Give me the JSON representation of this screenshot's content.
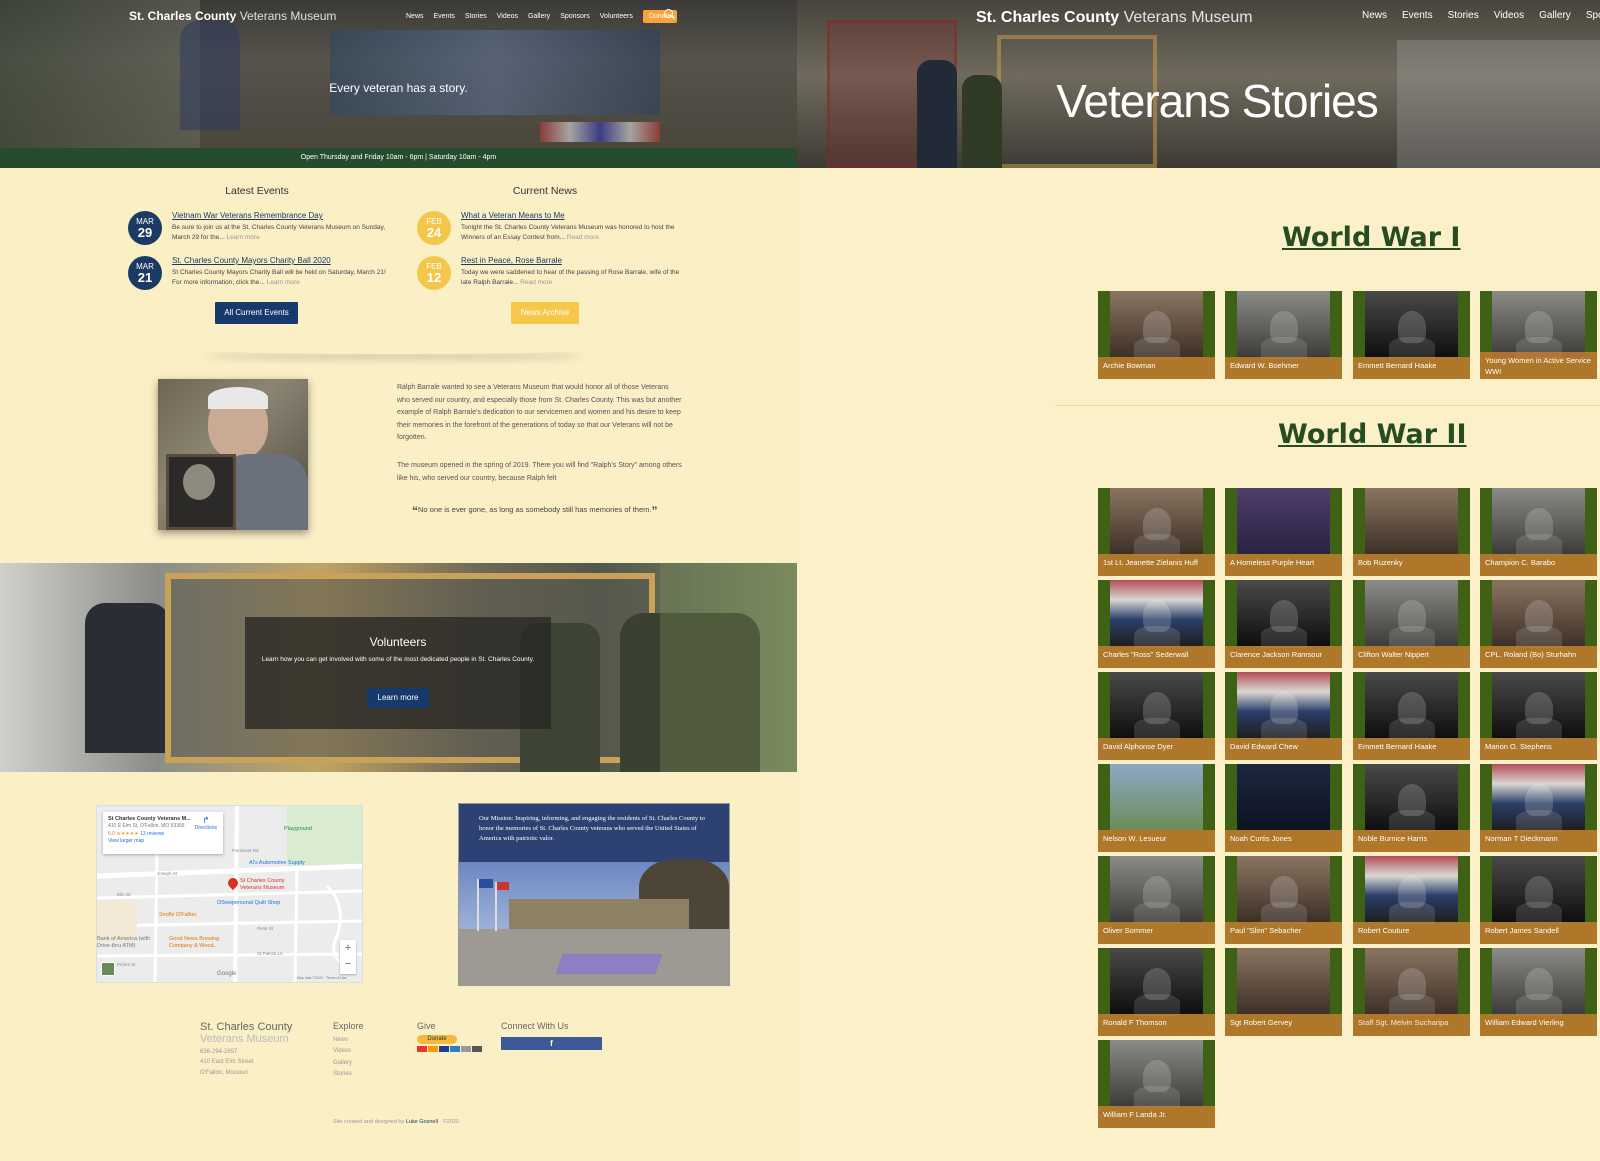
{
  "left_site": {
    "brand": {
      "main": "St. Charles County",
      "sub": "Veterans Museum"
    },
    "nav": [
      "News",
      "Events",
      "Stories",
      "Videos",
      "Gallery",
      "Sponsors",
      "Volunteers"
    ],
    "donate_label": "Donate",
    "tagline": "Every veteran has a story.",
    "hours": "Open Thursday and Friday 10am - 6pm | Saturday 10am - 4pm",
    "latest_events": {
      "heading": "Latest Events",
      "items": [
        {
          "month": "MAR",
          "day": "29",
          "title": "Vietnam War Veterans Remembrance Day",
          "body": "Be sure to join us at the St. Charles County Veterans Museum on Sunday, March 29 for the...",
          "more": "Learn more"
        },
        {
          "month": "MAR",
          "day": "21",
          "title": "St. Charles County Mayors Charity Ball 2020",
          "body": "St Charles County Mayors Charity Ball will be held on Saturday, March 21! For more information, click the...",
          "more": "Learn more"
        }
      ],
      "button": "All Current Events"
    },
    "current_news": {
      "heading": "Current News",
      "items": [
        {
          "month": "FEB",
          "day": "24",
          "title": "What a Veteran Means to Me",
          "body": "Tonight the St. Charles County Veterans Museum was honored to host the Winners of an Essay Contest from...",
          "more": "Read more"
        },
        {
          "month": "FEB",
          "day": "12",
          "title": "Rest in Peace, Rose Barrale",
          "body": "Today we were saddened to hear of the passing of Rose Barrale, wife of the late Ralph Barrale...",
          "more": "Read more"
        }
      ],
      "button": "News Archive"
    },
    "about": {
      "p1": "Ralph Barrale wanted to see a Veterans Museum that would honor all of those Veterans who served our country, and especially those from St. Charles County. This was but another example of Ralph Barrale's dedication to our servicemen and women and his desire to keep their memories in the forefront of the generations of today so that our Veterans will not be forgotten.",
      "p2": "The museum opened in the spring of 2019. There you will find \"Ralph's Story\" among others like his, who served our country, because Ralph felt",
      "quote": "No one is ever gone, as long as somebody still has memories of them."
    },
    "volunteers": {
      "heading": "Volunteers",
      "body": "Learn how you can get involved with some of the most dedicated people in St. Charles County.",
      "button": "Learn more"
    },
    "map": {
      "place": "St Charles County Veterans M...",
      "address": "410 E Elm St, O'Fallon, MO 63366",
      "rating": "5.0",
      "stars": "★★★★★",
      "reviews": "13 reviews",
      "larger": "View larger map",
      "directions": "Directions",
      "pin_label": "St Charles County Veterans Museum",
      "places": [
        "Playground",
        "Al's Automotive Supply",
        "OSewpersonal Quilt Shop",
        "Snoflz O'Fallon",
        "Good News Brewing Company & Wood...",
        "Bank of America (with Drive-thru ATM)"
      ],
      "streets": [
        "Joseph St",
        "Elm St",
        "Fiorissant Rd",
        "Primm St",
        "Penn St",
        "St Patrick Ln"
      ],
      "zoom_in": "+",
      "zoom_out": "−",
      "google": "Google",
      "attribution": "Map data ©2020 · Terms of Use"
    },
    "mission": "Our Mission: Inspiring, informing, and engaging the residents of St. Charles County to honor the memories of St. Charles County veterans who served the United States of America with patriotic valor.",
    "footer": {
      "brand_main": "St. Charles County",
      "brand_sub": "Veterans Museum",
      "phone": "636-294-2657",
      "street": "410 East Elm Street",
      "city": "O'Fallon, Missouri",
      "explore_heading": "Explore",
      "explore_links": [
        "News",
        "Videos",
        "Gallery",
        "Stories"
      ],
      "give_heading": "Give",
      "give_button": "Donate",
      "connect_heading": "Connect With Us",
      "facebook": "f",
      "credit_prefix": "Site created and designed by",
      "credit_name": "Luke Gosnell",
      "credit_year": "· ©2020"
    }
  },
  "right_site": {
    "brand": {
      "main": "St. Charles County",
      "sub": "Veterans Museum"
    },
    "nav": [
      "News",
      "Events",
      "Stories",
      "Videos",
      "Gallery",
      "Sponsors"
    ],
    "title": "Veterans Stories",
    "sections": [
      {
        "heading": "World War I",
        "people": [
          "Archie Bowman",
          "Edward W. Boehmer",
          "Emmett Bernard Haake",
          "Young Women in Active Service WWI"
        ]
      },
      {
        "heading": "World War II",
        "people": [
          "1st Lt. Jeanette Zielanis Huff",
          "A Homeless Purple Heart",
          "Bob Ruzenky",
          "Champion C. Barabo",
          "Charles \"Ross\" Sederwall",
          "Clarence Jackson Ramsour",
          "Clifton Walter Nippert",
          "CPL. Roland (Bo) Sturhahn",
          "David Alphonse Dyer",
          "David Edward Chew",
          "Emmett Bernard Haake",
          "Marion O. Stephens",
          "Nelson W. Lesueur",
          "Noah Curtis Jones",
          "Noble Burnice Harris",
          "Norman T Dieckmann",
          "Oliver Sommer",
          "Paul \"Slim\" Sebacher",
          "Robert Couture",
          "Robert James Sandell",
          "Ronald F Thomson",
          "Sgt Robert Gervey",
          "Staff Sgt. Melvin Sucharipa",
          "William Edward Vierling",
          "William F Landa Jr."
        ]
      }
    ]
  }
}
